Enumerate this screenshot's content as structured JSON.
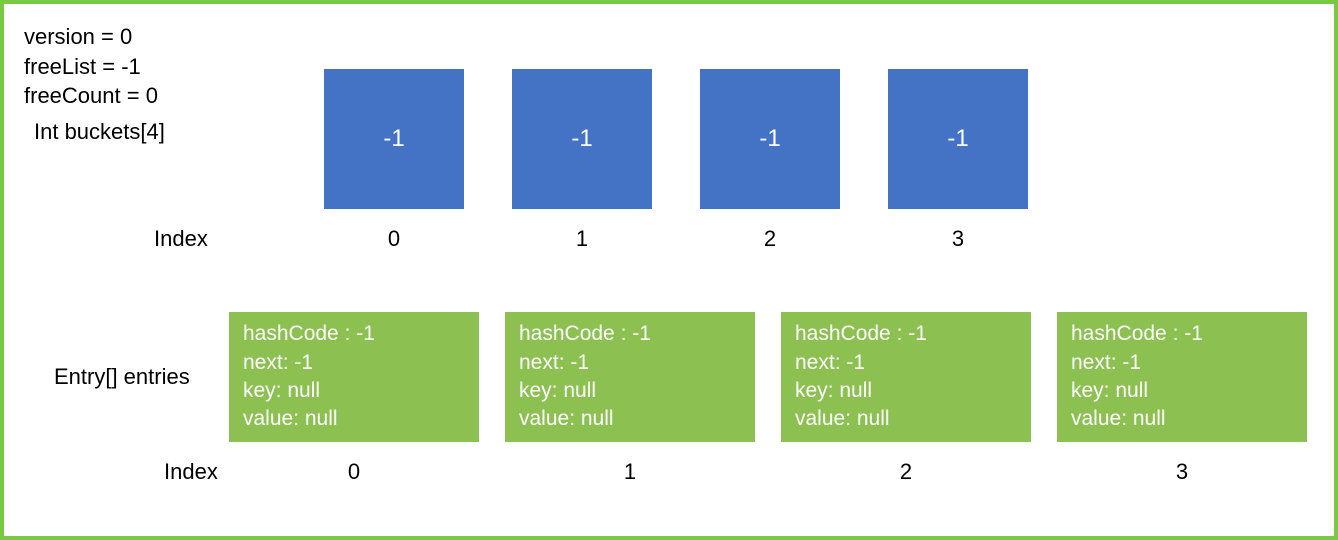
{
  "vars": {
    "line1": "version = 0",
    "line2": "freeList = -1",
    "line3": "freeCount = 0"
  },
  "buckets": {
    "label": "Int buckets[4]",
    "index_label": "Index",
    "items": [
      "-1",
      "-1",
      "-1",
      "-1"
    ],
    "indices": [
      "0",
      "1",
      "2",
      "3"
    ]
  },
  "entries": {
    "label": "Entry[] entries",
    "index_label": "Index",
    "items": [
      {
        "hashCode": "hashCode : -1",
        "next": "next: -1",
        "key": "key: null",
        "value": "value: null"
      },
      {
        "hashCode": "hashCode : -1",
        "next": "next: -1",
        "key": "key: null",
        "value": "value: null"
      },
      {
        "hashCode": "hashCode : -1",
        "next": "next: -1",
        "key": "key: null",
        "value": "value: null"
      },
      {
        "hashCode": "hashCode : -1",
        "next": "next: -1",
        "key": "key: null",
        "value": "value: null"
      }
    ],
    "indices": [
      "0",
      "1",
      "2",
      "3"
    ]
  }
}
